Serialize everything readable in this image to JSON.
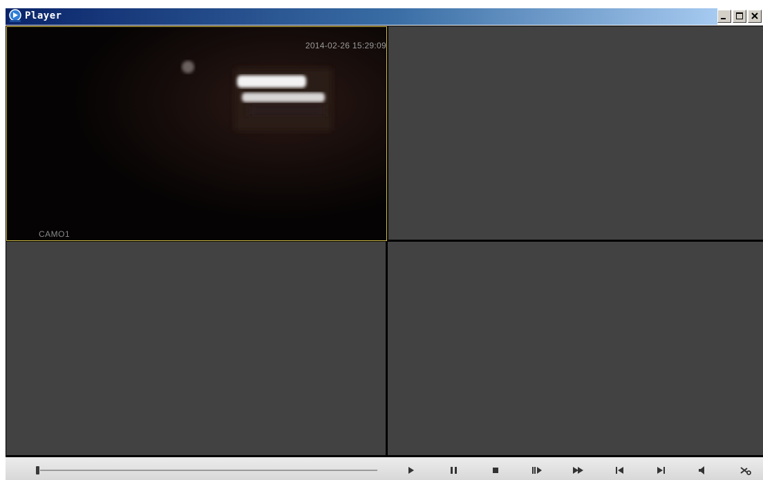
{
  "window": {
    "title": "Player",
    "icon": "app-logo-icon",
    "buttons": [
      "minimize-icon",
      "maximize-icon",
      "close-icon"
    ]
  },
  "grid": {
    "layout": "2x2",
    "active_cell": 1,
    "cells": [
      {
        "index": 1,
        "timestamp": "2014-02-26 15:29:09",
        "camera_label": "CAMO1",
        "has_video": true
      },
      {
        "index": 2,
        "has_video": false
      },
      {
        "index": 3,
        "has_video": false
      },
      {
        "index": 4,
        "has_video": false
      }
    ]
  },
  "controls": {
    "seek_progress": 0.0,
    "buttons": [
      "play-icon",
      "pause-icon",
      "stop-icon",
      "slow-icon",
      "fast-forward-icon",
      "previous-frame-icon",
      "next-frame-icon",
      "volume-icon",
      "scissors-icon"
    ]
  },
  "colors": {
    "titlebar_start": "#0a246a",
    "titlebar_end": "#a6caf0",
    "empty_cell": "#424242",
    "active_border": "#d6c24a"
  }
}
